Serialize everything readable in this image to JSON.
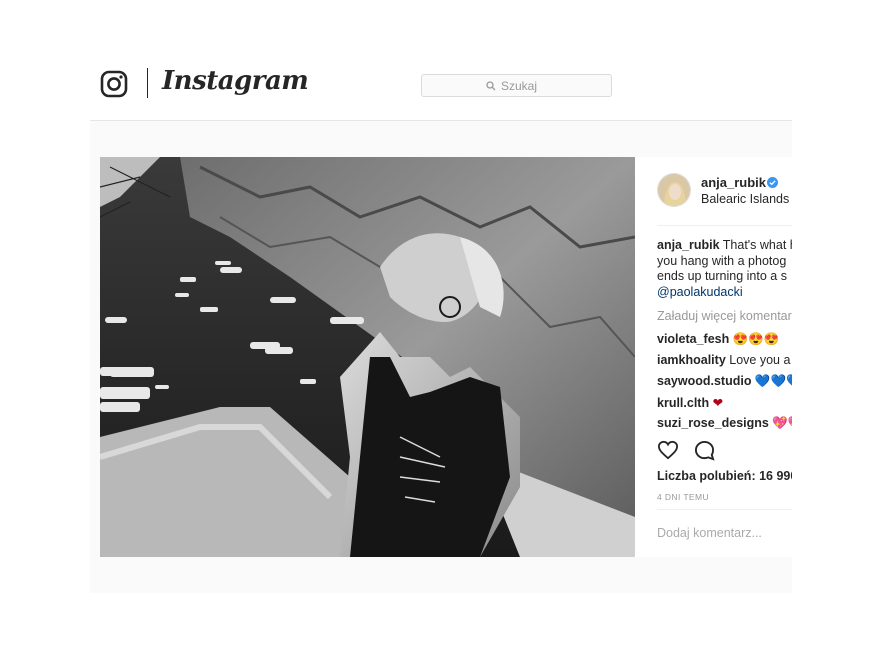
{
  "header": {
    "wordmark": "Instagram",
    "search": {
      "placeholder": "Szukaj"
    }
  },
  "post": {
    "username": "anja_rubik",
    "location": "Balearic Islands",
    "verified": true,
    "caption": {
      "username": "anja_rubik",
      "line1": "That's what h",
      "line2": "you hang with a photog",
      "line3": "ends up turning into a s",
      "mention": "@paolakudacki"
    },
    "load_more": "Załaduj więcej komentar",
    "comments": [
      {
        "user": "violeta_fesh",
        "text": " 😍😍😍"
      },
      {
        "user": "iamkhoality",
        "text": " Love you a"
      },
      {
        "user": "saywood.studio",
        "text": " 💙💙💙"
      },
      {
        "user": "krull.clth",
        "text": " ❤"
      },
      {
        "user": "suzi_rose_designs",
        "text": " 💖💖"
      }
    ],
    "likes": "Liczba polubień: 16 990",
    "time": "4 DNI TEMU",
    "add_comment_placeholder": "Dodaj komentarz..."
  },
  "icons": {
    "logo": "instagram-camera-icon",
    "search": "search-icon",
    "verified": "verified-badge-icon",
    "like": "heart-icon",
    "comment": "comment-icon"
  },
  "colors": {
    "text": "#262626",
    "muted": "#999999",
    "link": "#003569",
    "verified": "#3897f0",
    "border": "#dbdbdb",
    "stage": "#fafafa"
  }
}
